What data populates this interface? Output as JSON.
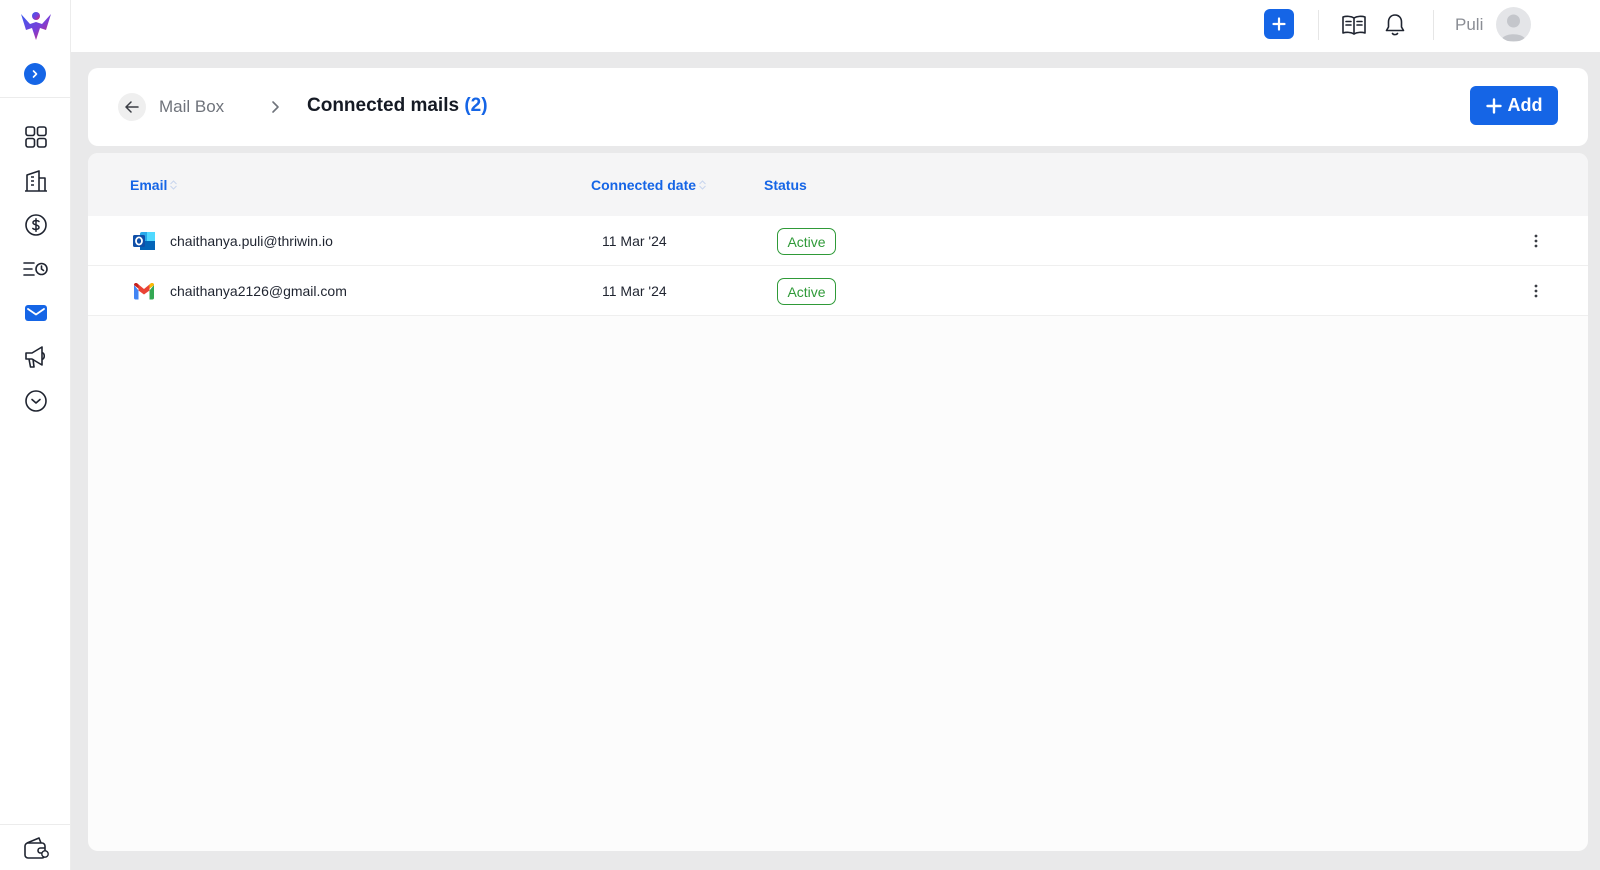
{
  "topbar": {
    "user_name": "Puli"
  },
  "breadcrumb": {
    "parent": "Mail Box",
    "current": "Connected mails",
    "count": "(2)"
  },
  "header": {
    "add_label": "Add"
  },
  "table": {
    "columns": [
      "Email",
      "Connected date",
      "Status"
    ],
    "rows": [
      {
        "provider": "outlook-icon",
        "email": "chaithanya.puli@thriwin.io",
        "date": "11 Mar '24",
        "status": "Active"
      },
      {
        "provider": "gmail-icon",
        "email": "chaithanya2126@gmail.com",
        "date": "11 Mar '24",
        "status": "Active"
      }
    ]
  },
  "icons": {
    "sidebar": [
      "dashboard-grid-icon",
      "building-icon",
      "dollar-circle-icon",
      "list-clock-icon",
      "mail-icon",
      "megaphone-icon",
      "chevron-down-circle-icon"
    ],
    "sidebar_bottom": "wallet-icon",
    "topbar": [
      "plus-icon",
      "book-open-icon",
      "bell-icon",
      "avatar"
    ]
  },
  "colors": {
    "accent": "#1565e6",
    "active_status": "#2f9a38",
    "background": "#e9e9ea"
  }
}
